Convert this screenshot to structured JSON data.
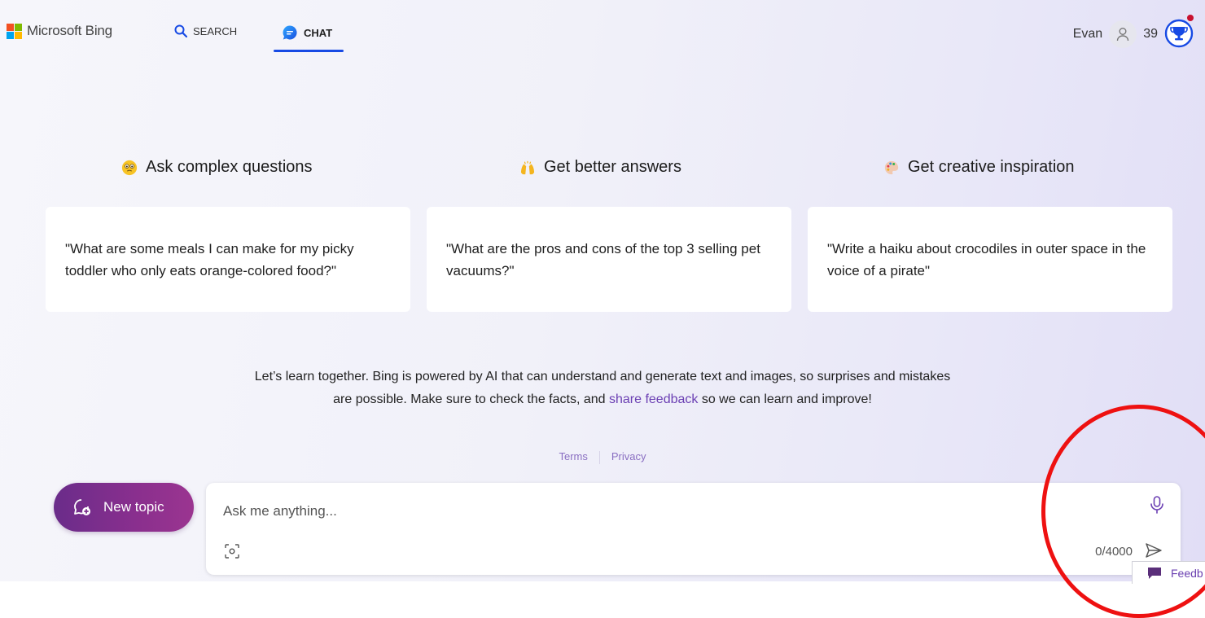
{
  "header": {
    "brand": "Microsoft Bing",
    "nav": {
      "search_label": "SEARCH",
      "chat_label": "CHAT"
    },
    "user": {
      "name": "Evan",
      "points": "39"
    }
  },
  "features": [
    {
      "heading": "Ask complex questions",
      "emoji": "face-with-monocle-emoji",
      "prompt": "\"What are some meals I can make for my picky toddler who only eats orange-colored food?\""
    },
    {
      "heading": "Get better answers",
      "emoji": "raising-hands-emoji",
      "prompt": "\"What are the pros and cons of the top 3 selling pet vacuums?\""
    },
    {
      "heading": "Get creative inspiration",
      "emoji": "artist-palette-emoji",
      "prompt": "\"Write a haiku about crocodiles in outer space in the voice of a pirate\""
    }
  ],
  "disclaimer": {
    "text_before": "Let’s learn together. Bing is powered by AI that can understand and generate text and images, so surprises and mistakes are possible. Make sure to check the facts, and ",
    "link": "share feedback",
    "text_after": " so we can learn and improve!"
  },
  "links": {
    "terms": "Terms",
    "privacy": "Privacy"
  },
  "composer": {
    "new_topic_label": "New topic",
    "placeholder": "Ask me anything...",
    "char_count": "0/4000"
  },
  "feedback_tab_label": "Feedb",
  "colors": {
    "accent_blue": "#174ae4",
    "new_topic_purple": "#7a2e8c",
    "link_purple": "#6b3fb3",
    "annotation_red": "#ee1111"
  }
}
